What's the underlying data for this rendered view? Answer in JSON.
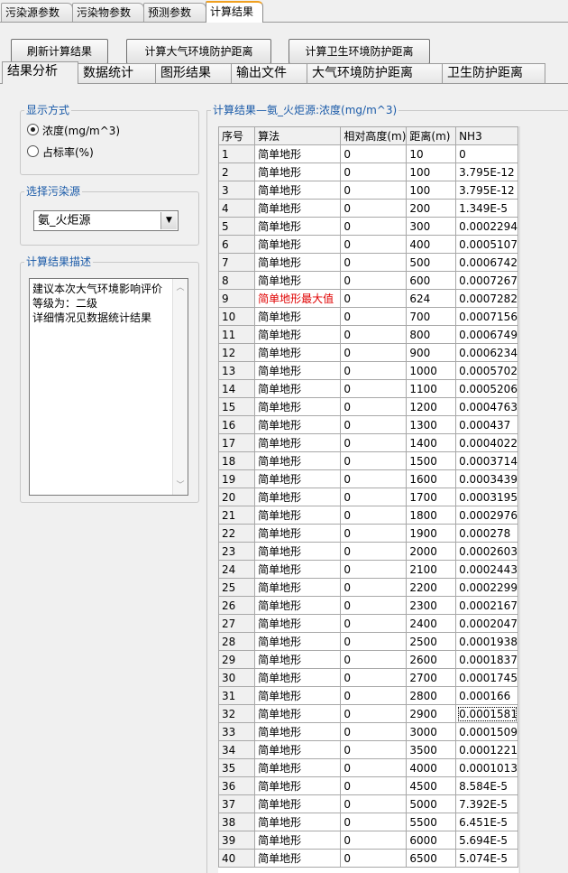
{
  "top_tabs": [
    "污染源参数",
    "污染物参数",
    "预测参数",
    "计算结果"
  ],
  "buttons": {
    "refresh": "刷新计算结果",
    "atmospheric": "计算大气环境防护距离",
    "sanitary": "计算卫生环境防护距离"
  },
  "sub_tabs": [
    "结果分析",
    "数据统计",
    "图形结果",
    "输出文件",
    "大气环境防护距离",
    "卫生防护距离"
  ],
  "display_mode": {
    "title": "显示方式",
    "options": [
      "浓度(mg/m^3)",
      "占标率(%)"
    ],
    "selected": "浓度(mg/m^3)"
  },
  "source_select": {
    "title": "选择污染源",
    "value": "氨_火炬源"
  },
  "description": {
    "title": "计算结果描述",
    "lines": [
      "建议本次大气环境影响评价",
      "等级为：二级",
      "详细情况见数据统计结果"
    ]
  },
  "results": {
    "title": "计算结果—氨_火炬源:浓度(mg/m^3)",
    "columns": [
      "序号",
      "算法",
      "相对高度(m)",
      "距离(m)",
      "NH3"
    ],
    "rows": [
      [
        "1",
        "简单地形",
        "0",
        "10",
        "0"
      ],
      [
        "2",
        "简单地形",
        "0",
        "100",
        "3.795E-12"
      ],
      [
        "3",
        "简单地形",
        "0",
        "100",
        "3.795E-12"
      ],
      [
        "4",
        "简单地形",
        "0",
        "200",
        "1.349E-5"
      ],
      [
        "5",
        "简单地形",
        "0",
        "300",
        "0.0002294"
      ],
      [
        "6",
        "简单地形",
        "0",
        "400",
        "0.0005107"
      ],
      [
        "7",
        "简单地形",
        "0",
        "500",
        "0.0006742"
      ],
      [
        "8",
        "简单地形",
        "0",
        "600",
        "0.0007267"
      ],
      [
        "9",
        "简单地形最大值",
        "0",
        "624",
        "0.0007282"
      ],
      [
        "10",
        "简单地形",
        "0",
        "700",
        "0.0007156"
      ],
      [
        "11",
        "简单地形",
        "0",
        "800",
        "0.0006749"
      ],
      [
        "12",
        "简单地形",
        "0",
        "900",
        "0.0006234"
      ],
      [
        "13",
        "简单地形",
        "0",
        "1000",
        "0.0005702"
      ],
      [
        "14",
        "简单地形",
        "0",
        "1100",
        "0.0005206"
      ],
      [
        "15",
        "简单地形",
        "0",
        "1200",
        "0.0004763"
      ],
      [
        "16",
        "简单地形",
        "0",
        "1300",
        "0.000437"
      ],
      [
        "17",
        "简单地形",
        "0",
        "1400",
        "0.0004022"
      ],
      [
        "18",
        "简单地形",
        "0",
        "1500",
        "0.0003714"
      ],
      [
        "19",
        "简单地形",
        "0",
        "1600",
        "0.0003439"
      ],
      [
        "20",
        "简单地形",
        "0",
        "1700",
        "0.0003195"
      ],
      [
        "21",
        "简单地形",
        "0",
        "1800",
        "0.0002976"
      ],
      [
        "22",
        "简单地形",
        "0",
        "1900",
        "0.000278"
      ],
      [
        "23",
        "简单地形",
        "0",
        "2000",
        "0.0002603"
      ],
      [
        "24",
        "简单地形",
        "0",
        "2100",
        "0.0002443"
      ],
      [
        "25",
        "简单地形",
        "0",
        "2200",
        "0.0002299"
      ],
      [
        "26",
        "简单地形",
        "0",
        "2300",
        "0.0002167"
      ],
      [
        "27",
        "简单地形",
        "0",
        "2400",
        "0.0002047"
      ],
      [
        "28",
        "简单地形",
        "0",
        "2500",
        "0.0001938"
      ],
      [
        "29",
        "简单地形",
        "0",
        "2600",
        "0.0001837"
      ],
      [
        "30",
        "简单地形",
        "0",
        "2700",
        "0.0001745"
      ],
      [
        "31",
        "简单地形",
        "0",
        "2800",
        "0.000166"
      ],
      [
        "32",
        "简单地形",
        "0",
        "2900",
        "0.0001581"
      ],
      [
        "33",
        "简单地形",
        "0",
        "3000",
        "0.0001509"
      ],
      [
        "34",
        "简单地形",
        "0",
        "3500",
        "0.0001221"
      ],
      [
        "35",
        "简单地形",
        "0",
        "4000",
        "0.0001013"
      ],
      [
        "36",
        "简单地形",
        "0",
        "4500",
        "8.584E-5"
      ],
      [
        "37",
        "简单地形",
        "0",
        "5000",
        "7.392E-5"
      ],
      [
        "38",
        "简单地形",
        "0",
        "5500",
        "6.451E-5"
      ],
      [
        "39",
        "简单地形",
        "0",
        "6000",
        "5.694E-5"
      ],
      [
        "40",
        "简单地形",
        "0",
        "6500",
        "5.074E-5"
      ]
    ],
    "highlight_row": "9",
    "focused_row": "32",
    "colors": {
      "max_value_text": "#e00000",
      "group_title": "#1a5aa8",
      "active_tab_accent": "#f0a020"
    }
  }
}
